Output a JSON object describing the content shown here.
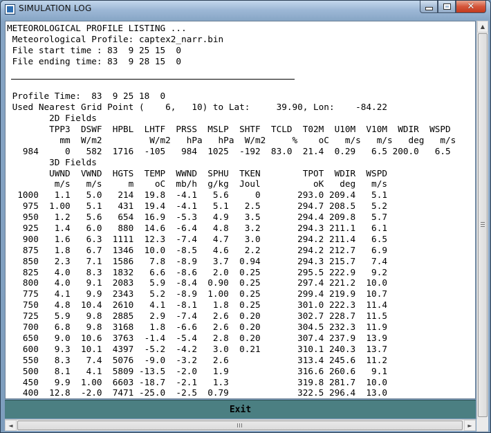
{
  "window": {
    "title": "SIMULATION LOG",
    "icons": {
      "app": "app-icon",
      "minimize": "minimize-icon",
      "maximize": "maximize-icon",
      "close": "close-icon"
    }
  },
  "log": {
    "lines": [
      "METEOROLOGICAL PROFILE LISTING ...",
      " Meteorological Profile: captex2_narr.bin",
      " File start time : 83  9 25 15  0",
      " File ending time: 83  9 28 15  0",
      "",
      "",
      " Profile Time:  83  9 25 18  0",
      " Used Nearest Grid Point (    6,   10) to Lat:     39.90, Lon:    -84.22",
      "        2D Fields",
      "        TPP3  DSWF  HPBL  LHTF  PRSS  MSLP  SHTF  TCLD  T02M  U10M  V10M  WDIR  WSPD",
      "          mm  W/m2         W/m2   hPa   hPa  W/m2     %    oC   m/s   m/s   deg   m/s",
      "   984     0   582  1716  -105   984  1025  -192  83.0  21.4  0.29   6.5 200.0   6.5",
      "        3D Fields",
      "        UWND  VWND  HGTS  TEMP  WWND  SPHU  TKEN        TPOT  WDIR  WSPD",
      "         m/s   m/s     m    oC  mb/h  g/kg  Joul          oK   deg   m/s",
      "  1000   1.1   5.0   214  19.8  -4.1   5.6     0       293.0 209.4   5.1",
      "   975  1.00   5.1   431  19.4  -4.1   5.1   2.5       294.7 208.5   5.2",
      "   950   1.2   5.6   654  16.9  -5.3   4.9   3.5       294.4 209.8   5.7",
      "   925   1.4   6.0   880  14.6  -6.4   4.8   3.2       294.3 211.1   6.1",
      "   900   1.6   6.3  1111  12.3  -7.4   4.7   3.0       294.2 211.4   6.5",
      "   875   1.8   6.7  1346  10.0  -8.5   4.6   2.2       294.2 212.7   6.9",
      "   850   2.3   7.1  1586   7.8  -8.9   3.7  0.94       294.3 215.7   7.4",
      "   825   4.0   8.3  1832   6.6  -8.6   2.0  0.25       295.5 222.9   9.2",
      "   800   4.0   9.1  2083   5.9  -8.4  0.90  0.25       297.4 221.2  10.0",
      "   775   4.1   9.9  2343   5.2  -8.9  1.00  0.25       299.4 219.9  10.7",
      "   750   4.8  10.4  2610   4.1  -8.1   1.8  0.25       301.0 222.3  11.4",
      "   725   5.9   9.8  2885   2.9  -7.4   2.6  0.20       302.7 228.7  11.5",
      "   700   6.8   9.8  3168   1.8  -6.6   2.6  0.20       304.5 232.3  11.9",
      "   650   9.0  10.6  3763  -1.4  -5.4   2.8  0.20       307.4 237.9  13.9",
      "   600   9.3  10.1  4397  -5.2  -4.2   3.0  0.21       310.1 240.3  13.7",
      "   550   8.3   7.4  5076  -9.0  -3.2   2.6             313.4 245.6  11.2",
      "   500   8.1   4.1  5809 -13.5  -2.0   1.9             316.6 260.6   9.1",
      "   450   9.9  1.00  6603 -18.7  -2.1   1.3             319.8 281.7  10.0",
      "   400  12.8  -2.0  7471 -25.0  -2.5  0.79             322.5 296.4  13.0"
    ]
  },
  "exit_button": {
    "label": "Exit"
  },
  "scrollbars": {
    "up": "▲",
    "down": "▼",
    "left": "◄",
    "right": "►"
  }
}
